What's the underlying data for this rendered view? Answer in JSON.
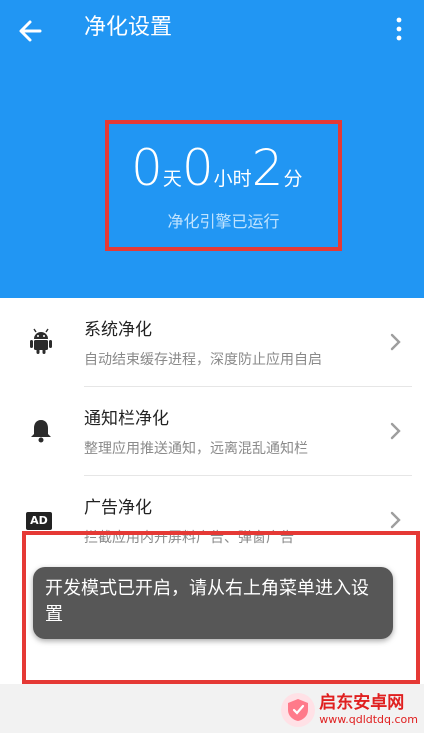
{
  "header": {
    "title": "净化设置",
    "back_icon": "arrow-left-icon",
    "menu_icon": "more-vert-icon",
    "background_color": "#2196f3"
  },
  "timer": {
    "days_value": "0",
    "days_unit": "天",
    "hours_value": "0",
    "hours_unit": "小时",
    "minutes_value": "2",
    "minutes_unit": "分",
    "status": "净化引擎已运行",
    "highlight_color": "#e53935"
  },
  "items": [
    {
      "title": "系统净化",
      "subtitle": "自动结束缓存进程，深度防止应用自启",
      "icon": "android-icon"
    },
    {
      "title": "通知栏净化",
      "subtitle": "整理应用推送通知，远离混乱通知栏",
      "icon": "bell-icon"
    },
    {
      "title": "广告净化",
      "subtitle": "拦截应用内开屏料广告、弹窗广告",
      "icon": "ad-icon",
      "icon_text": "AD"
    }
  ],
  "toast": {
    "message": "开发模式已开启，请从右上角菜单进入设置"
  },
  "watermark": {
    "name": "启东安卓网",
    "url": "www.qdldtdq.com"
  }
}
